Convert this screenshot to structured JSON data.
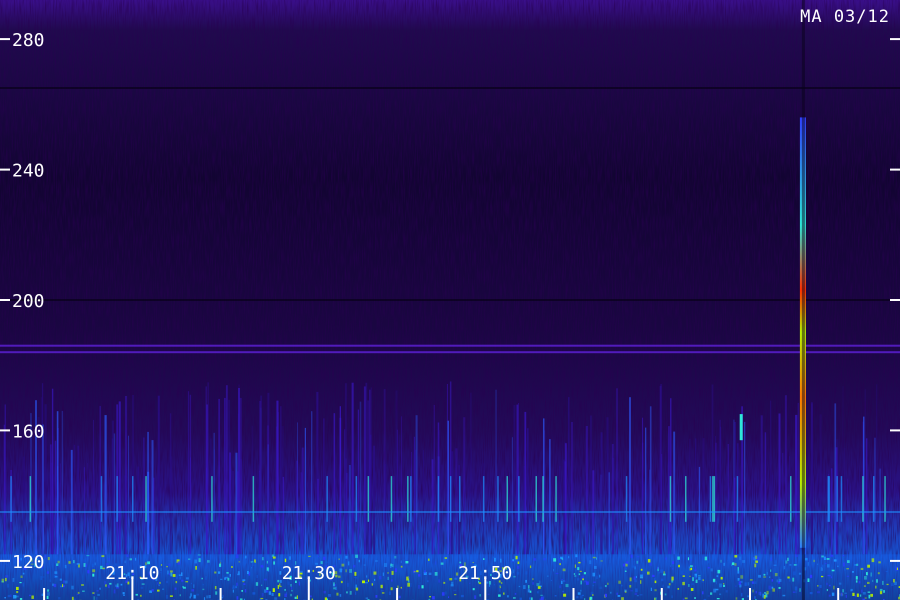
{
  "chart_data": {
    "type": "heatmap",
    "title": "MA 03/12",
    "xlabel": "",
    "ylabel": "",
    "y_ticks": [
      120,
      160,
      200,
      240,
      280
    ],
    "y_tick_labels": [
      "120",
      "160",
      "200",
      "240",
      "280"
    ],
    "ylim": [
      108,
      292
    ],
    "x_tick_labels": [
      "21:10",
      "21:30",
      "21:50"
    ],
    "x_tick_times_min": [
      0,
      10,
      20,
      30,
      40,
      50,
      60,
      70,
      80,
      90
    ],
    "x_labeled_times_min": [
      10,
      30,
      50
    ],
    "xlim_min": [
      -5,
      97
    ],
    "grid": false,
    "colormap": [
      "#0c0320",
      "#2a0a5e",
      "#4a12b0",
      "#2c3cff",
      "#1e90ff",
      "#2ee8d8",
      "#b8f000",
      "#ff3000"
    ],
    "horizontal_lines_freq": [
      186,
      184,
      200,
      265
    ],
    "vertical_events": [
      {
        "time_min": 86,
        "freq_from": 124,
        "freq_to": 256,
        "intensity": "strong"
      },
      {
        "time_min": 79,
        "freq_from": 157,
        "freq_to": 165,
        "intensity": "medium"
      }
    ],
    "noise_floor_freq": 122
  }
}
